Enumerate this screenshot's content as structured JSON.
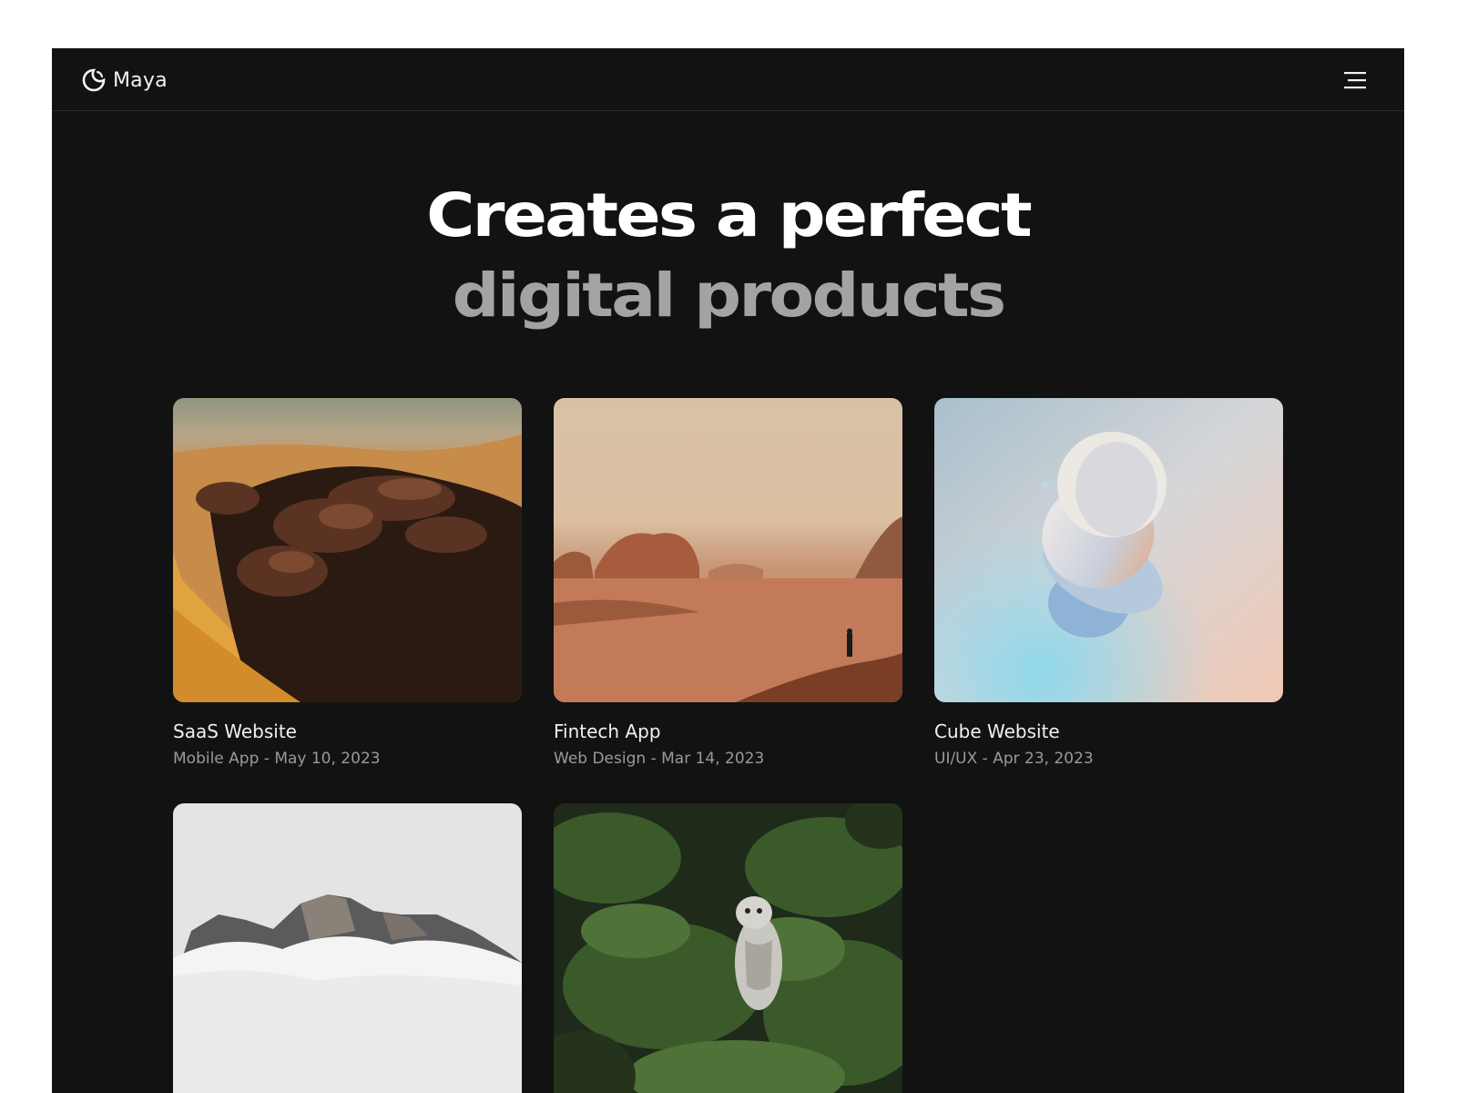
{
  "brand": {
    "name": "Maya",
    "logo_icon": "crescent-moon-icon"
  },
  "nav": {
    "menu_icon": "hamburger-menu-icon"
  },
  "hero": {
    "line1": "Creates a perfect",
    "line2": "digital products"
  },
  "projects": [
    {
      "title": "SaaS Website",
      "meta": "Mobile App - May 10, 2023",
      "image": "aerial desert rocks"
    },
    {
      "title": "Fintech App",
      "meta": "Web Design - Mar 14, 2023",
      "image": "desert landscape with person"
    },
    {
      "title": "Cube Website",
      "meta": "UI/UX - Apr 23, 2023",
      "image": "abstract 3d discs"
    },
    {
      "title": "",
      "meta": "",
      "image": "mountain peaks in clouds"
    },
    {
      "title": "",
      "meta": "",
      "image": "owl in pine tree"
    }
  ],
  "colors": {
    "background": "#121212",
    "text_primary": "#ffffff",
    "text_secondary": "#a3a3a3",
    "meta": "#9a9a9a"
  }
}
